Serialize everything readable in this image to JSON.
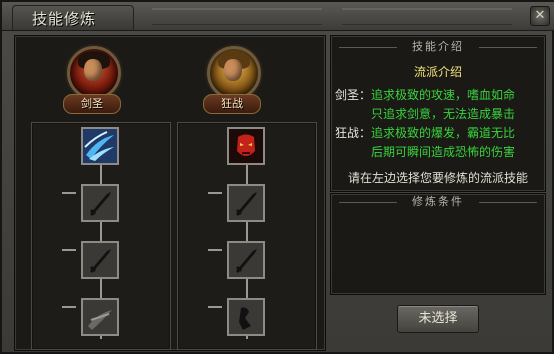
{
  "window": {
    "title": "技能修炼",
    "close_symbol": "✕"
  },
  "classes": [
    {
      "name": "剑圣",
      "portrait_icon": "swordsman-portrait"
    },
    {
      "name": "狂战",
      "portrait_icon": "berserker-portrait"
    }
  ],
  "skill_columns": [
    {
      "class": "剑圣",
      "skills": [
        "blue-slash-icon",
        "sword-locked-icon",
        "sword-locked-icon",
        "sword-locked-icon"
      ]
    },
    {
      "class": "狂战",
      "skills": [
        "red-demon-mask-icon",
        "sword-locked-icon",
        "sword-locked-icon",
        "sword-locked-icon"
      ]
    }
  ],
  "intro": {
    "header": "技能介绍",
    "title": "流派介绍",
    "lines": [
      {
        "label": "剑圣：",
        "text": "追求极致的攻速，嗜血如命"
      },
      {
        "label": "",
        "text": "只追求剑意，无法造成暴击"
      },
      {
        "label": "狂战：",
        "text": "追求极致的爆发，霸道无比"
      },
      {
        "label": "",
        "text": "后期可瞬间造成恐怖的伤害"
      }
    ],
    "hint": "请在左边选择您要修炼的流派技能"
  },
  "requirements": {
    "header": "修炼条件"
  },
  "confirm_button": {
    "label": "未选择"
  },
  "colors": {
    "highlight_text": "#39d33c",
    "title_text": "#f3e37b",
    "name_plate": "#6b3a21"
  }
}
